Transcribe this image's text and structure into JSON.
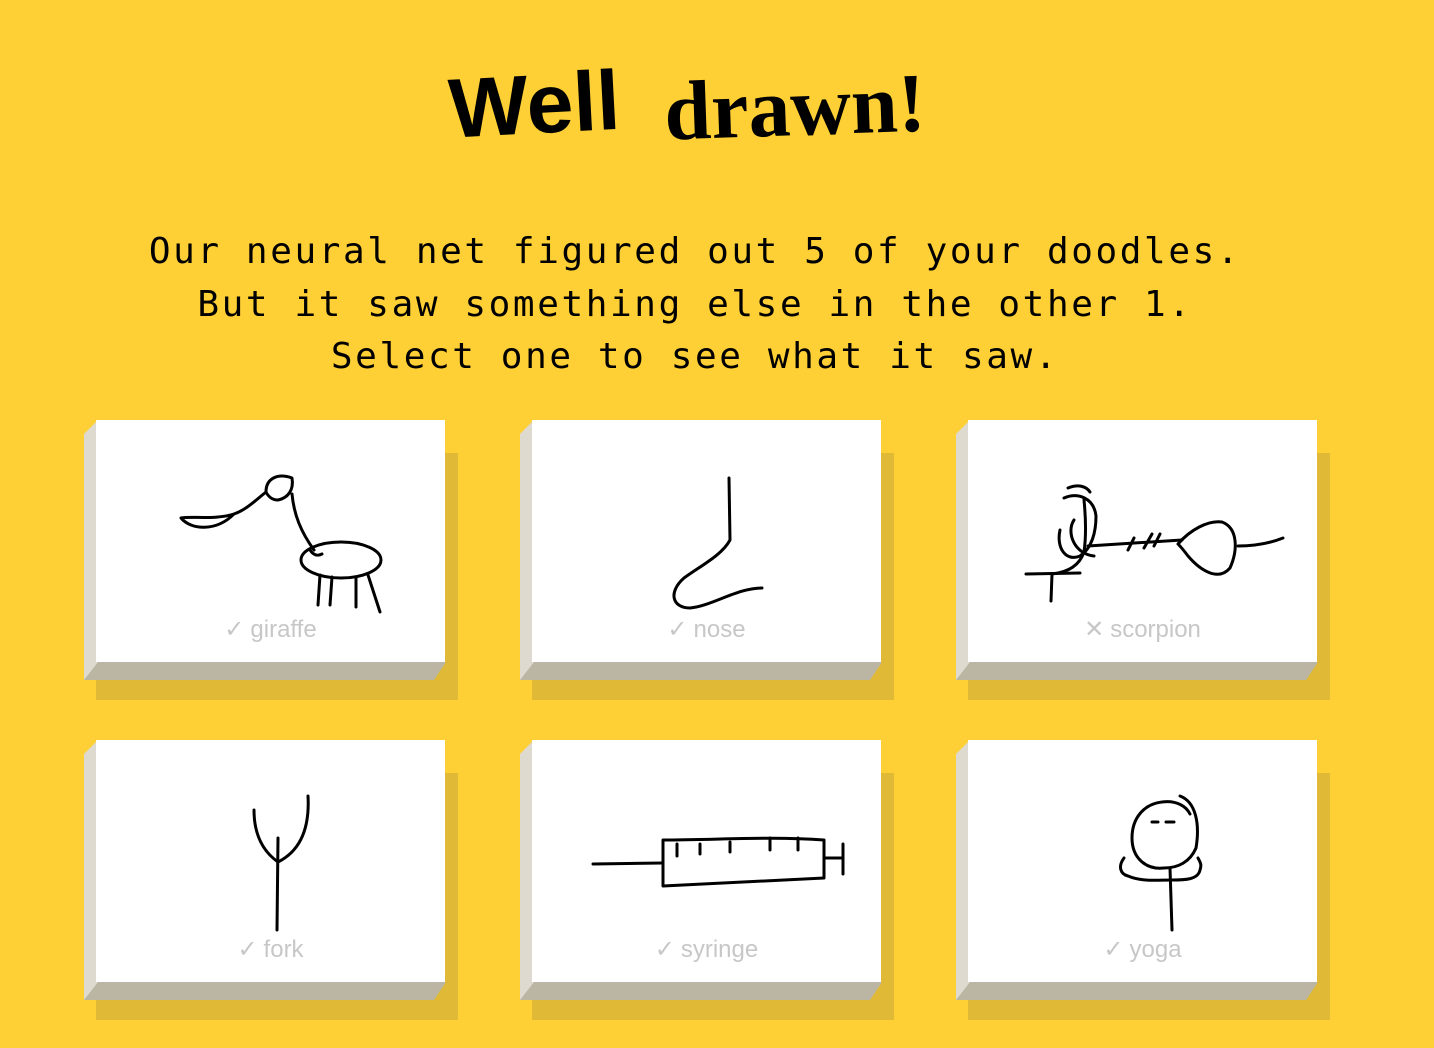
{
  "header": {
    "title_part1": "Well",
    "title_part2": "drawn!"
  },
  "message": {
    "line1": "Our neural net figured out 5 of your doodles.",
    "line2": "But it saw something else in the other 1.",
    "line3": "Select one to see what it saw."
  },
  "doodles": [
    {
      "label": "giraffe",
      "mark": "✓",
      "recognized": true
    },
    {
      "label": "nose",
      "mark": "✓",
      "recognized": true
    },
    {
      "label": "scorpion",
      "mark": "✕",
      "recognized": false
    },
    {
      "label": "fork",
      "mark": "✓",
      "recognized": true
    },
    {
      "label": "syringe",
      "mark": "✓",
      "recognized": true
    },
    {
      "label": "yoga",
      "mark": "✓",
      "recognized": true
    }
  ],
  "colors": {
    "background": "#FED035",
    "card_face": "#FFFFFF",
    "card_shadow": "#E0B936",
    "label": "#C7C7C7"
  }
}
